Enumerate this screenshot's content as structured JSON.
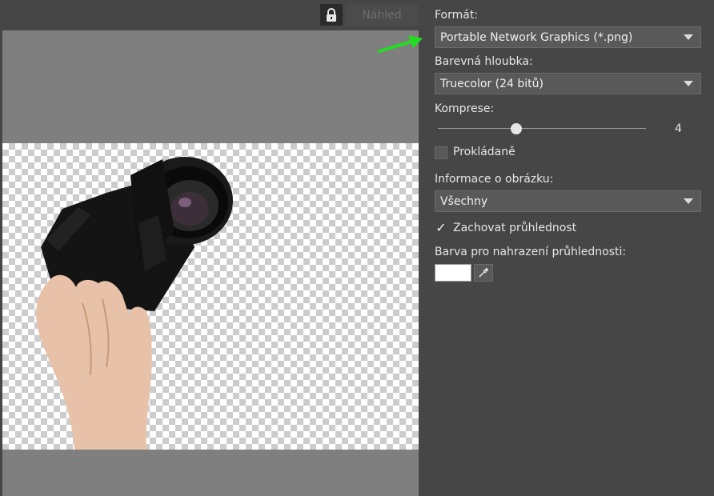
{
  "toolbar": {
    "lock_icon": "lock-icon",
    "preview_label": "Náhled"
  },
  "preview": {
    "subject": "hand holding camera"
  },
  "settings": {
    "format": {
      "label": "Formát:",
      "value": "Portable Network Graphics (*.png)"
    },
    "color_depth": {
      "label": "Barevná hloubka:",
      "value": "Truecolor (24 bitů)"
    },
    "compression": {
      "label": "Komprese:",
      "value": "4",
      "min": 0,
      "max": 9
    },
    "interlaced": {
      "label": "Prokládaně",
      "checked": false
    },
    "image_info": {
      "label": "Informace o obrázku:",
      "value": "Všechny"
    },
    "keep_transparency": {
      "label": "Zachovat průhlednost",
      "checked": true,
      "mark": "✓"
    },
    "transparency_color": {
      "label": "Barva pro nahrazení průhlednosti:",
      "color": "#ffffff",
      "picker_icon": "eyedropper-icon"
    }
  },
  "colors": {
    "background": "#464646",
    "preview_background": "#7f7f7f",
    "arrow": "#22dd22"
  }
}
